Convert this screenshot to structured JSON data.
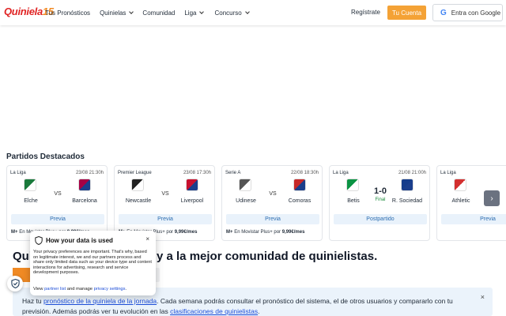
{
  "header": {
    "logo_text": "Quiniela",
    "logo_num": "15",
    "nav": [
      {
        "label": "Tus Pronósticos",
        "dropdown": false
      },
      {
        "label": "Quinielas",
        "dropdown": true
      },
      {
        "label": "Comunidad",
        "dropdown": false
      },
      {
        "label": "Liga",
        "dropdown": true
      },
      {
        "label": "Concurso",
        "dropdown": true
      }
    ],
    "register": "Regístrate",
    "account": "Tu Cuenta",
    "google": "Entra con Google"
  },
  "section_title": "Partidos Destacados",
  "matches": [
    {
      "league": "La Liga",
      "date": "23/08 21:30h",
      "home": "Elche",
      "away": "Barcelona",
      "mid": "VS",
      "score": "",
      "status": "",
      "button": "Previa",
      "tv_prefix": "En Movistar Plus+ por",
      "tv_price": "9,99€/mes",
      "home_color": "#1a7a3c",
      "away_color": "#a50044"
    },
    {
      "league": "Premier League",
      "date": "23/08 17:30h",
      "home": "Newcastle",
      "away": "Liverpool",
      "mid": "VS",
      "score": "",
      "status": "",
      "button": "Previa",
      "tv_prefix": "En Movistar Plus+ por",
      "tv_price": "9,99€/mes",
      "home_color": "#222222",
      "away_color": "#c8102e"
    },
    {
      "league": "Serie A",
      "date": "22/08 18:30h",
      "home": "Udinese",
      "away": "Comoras",
      "mid": "VS",
      "score": "",
      "status": "",
      "button": "Previa",
      "tv_prefix": "En Movistar Plus+ por",
      "tv_price": "9,99€/mes",
      "home_color": "#555555",
      "away_color": "#c62828"
    },
    {
      "league": "La Liga",
      "date": "21/08 21:00h",
      "home": "Betis",
      "away": "R. Sociedad",
      "mid": "",
      "score": "1-0",
      "status": "Final",
      "button": "Postpartido",
      "tv_prefix": "",
      "tv_price": "",
      "home_color": "#0b9444",
      "away_color": "#143c8b"
    },
    {
      "league": "La Liga",
      "date": "",
      "home": "Athletic",
      "away": "",
      "mid": "VS",
      "score": "",
      "status": "",
      "button": "Previa",
      "tv_prefix": "",
      "tv_price": "",
      "home_color": "#d32f2f",
      "away_color": "#ffffff"
    }
  ],
  "hero": {
    "left": "Qui",
    "right": "y a la mejor comunidad de quinielistas."
  },
  "info": {
    "t1": "Haz tu ",
    "l1": "pronóstico de la quiniela de la jornada",
    "t2": ". Cada semana podrás consultar el pronóstico del sistema, el de otros usuarios y compararlo con tu previsión. Además podrás ver tu evolución en las ",
    "l2": "clasificaciones de quinielistas",
    "t3": ".",
    "close": "×"
  },
  "consent": {
    "title": "How your data is used",
    "close": "×",
    "body": "Your privacy preferences are important. That's why, based on legitimate interest, we and our partners process and share only limited data such as your device type and content interactions for advertising, research and service development purposes.",
    "view": "View ",
    "partner_list": "partner list",
    "and_manage": " and manage ",
    "privacy_settings": "privacy settings",
    "end": "."
  },
  "colors": {
    "accent": "#f4a236",
    "brand_red": "#e02424",
    "link": "#1d4ed8",
    "banner": "#ebf3fb"
  }
}
